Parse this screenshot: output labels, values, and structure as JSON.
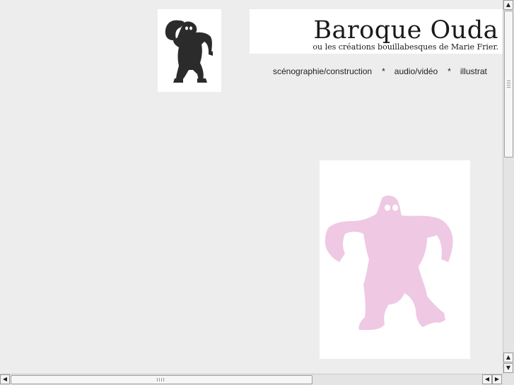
{
  "site": {
    "title": "Baroque Ouda",
    "subtitle": "ou les créations bouillabesques de Marie Frier."
  },
  "nav": {
    "items": [
      {
        "label": "scénographie/construction"
      },
      {
        "label": "audio/vidéo"
      },
      {
        "label": "illustrat"
      }
    ],
    "separator": "*"
  },
  "colors": {
    "page_background": "#ededed",
    "logo_gorilla": "#2b2b2b",
    "feature_gorilla": "#efc8e4"
  },
  "icons": {
    "logo": "gorilla-logo-icon",
    "feature": "pink-gorilla-icon"
  }
}
